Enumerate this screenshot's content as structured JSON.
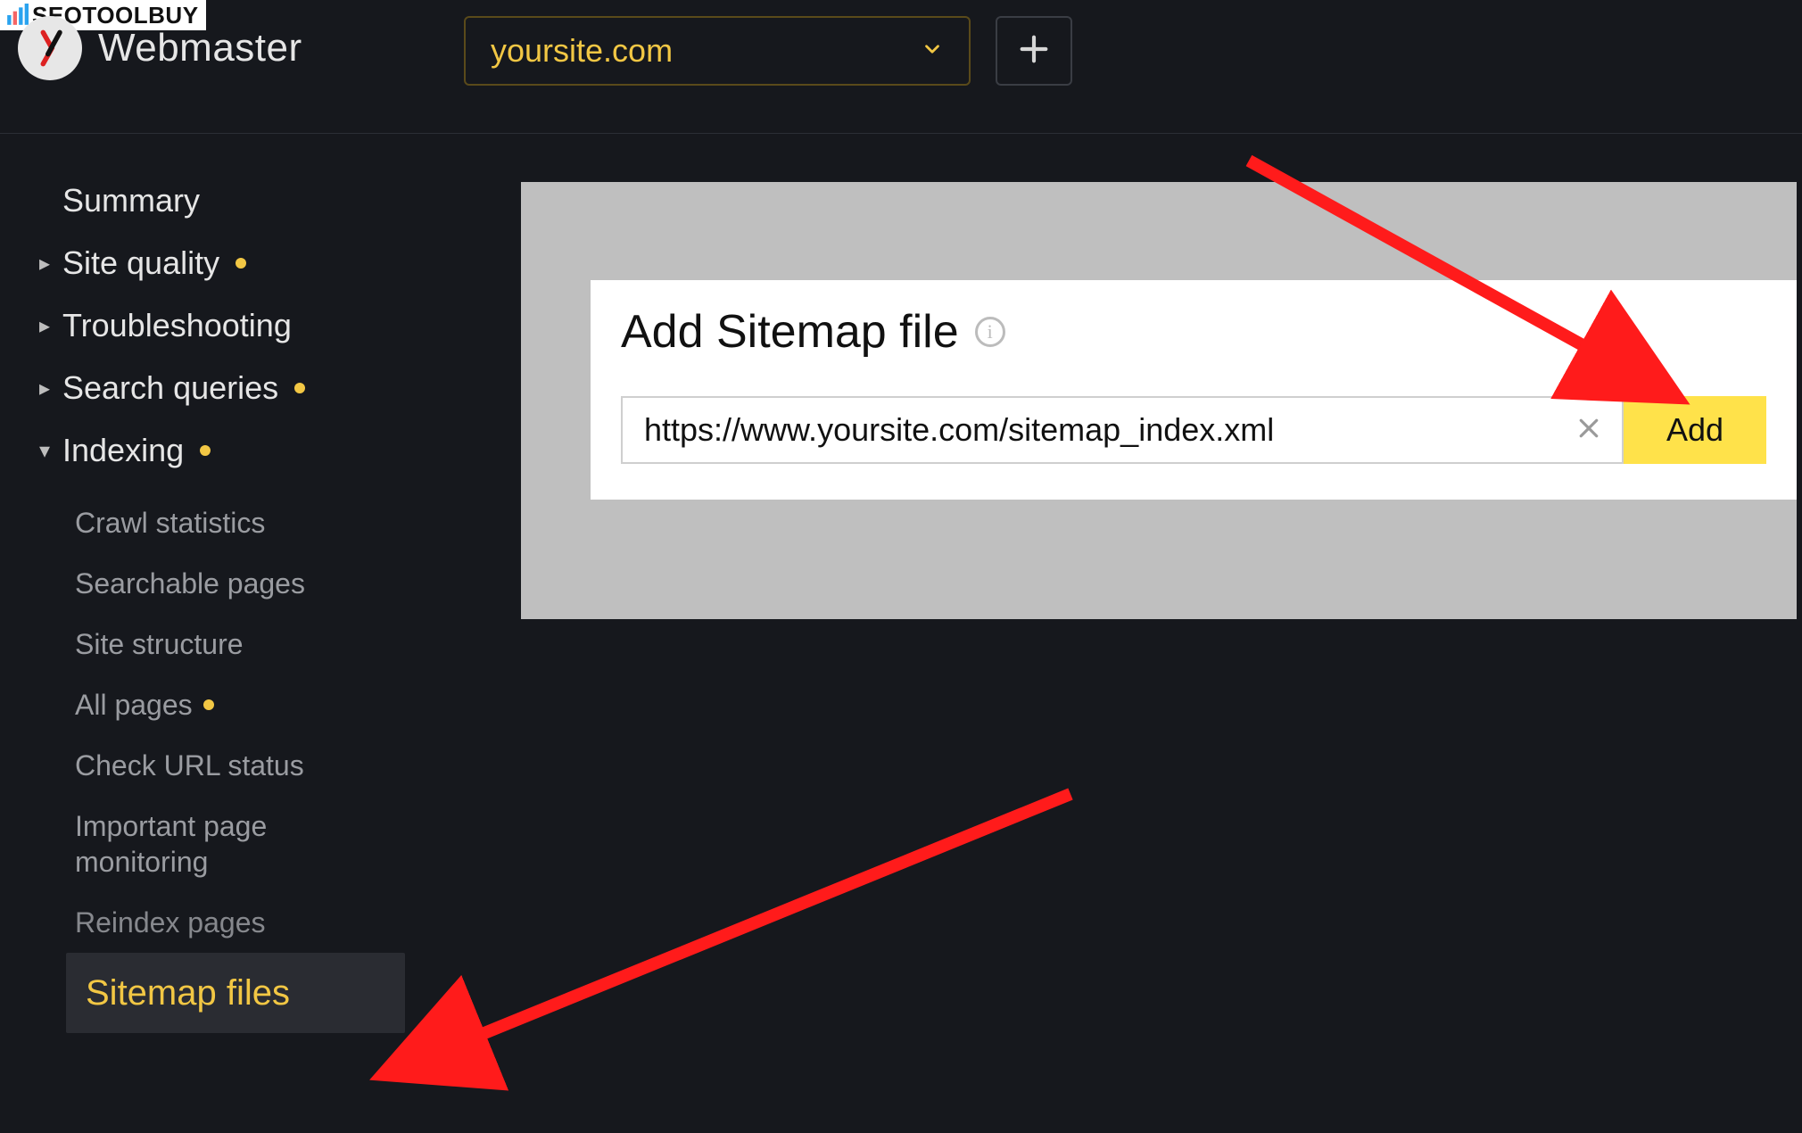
{
  "watermark": {
    "text": "SEOTOOLBUY"
  },
  "header": {
    "brand": "Webmaster",
    "site_selector": {
      "label": "yoursite.com"
    }
  },
  "sidebar": {
    "items": [
      {
        "label": "Summary",
        "has_caret": false,
        "has_dot": false,
        "expanded": false
      },
      {
        "label": "Site quality",
        "has_caret": true,
        "has_dot": true,
        "expanded": false
      },
      {
        "label": "Troubleshooting",
        "has_caret": true,
        "has_dot": false,
        "expanded": false
      },
      {
        "label": "Search queries",
        "has_caret": true,
        "has_dot": true,
        "expanded": false
      },
      {
        "label": "Indexing",
        "has_caret": true,
        "has_dot": true,
        "expanded": true,
        "children": [
          {
            "label": "Crawl statistics",
            "has_dot": false,
            "active": false
          },
          {
            "label": "Searchable pages",
            "has_dot": false,
            "active": false
          },
          {
            "label": "Site structure",
            "has_dot": false,
            "active": false
          },
          {
            "label": "All pages",
            "has_dot": true,
            "active": false
          },
          {
            "label": "Check URL status",
            "has_dot": false,
            "active": false
          },
          {
            "label": "Important page monitoring",
            "has_dot": false,
            "active": false
          },
          {
            "label": "Reindex pages",
            "has_dot": false,
            "active": false
          },
          {
            "label": "Sitemap files",
            "has_dot": false,
            "active": true
          }
        ]
      }
    ]
  },
  "panel": {
    "title": "Add Sitemap file",
    "info_glyph": "i",
    "input_value": "https://www.yoursite.com/sitemap_index.xml",
    "add_label": "Add"
  }
}
